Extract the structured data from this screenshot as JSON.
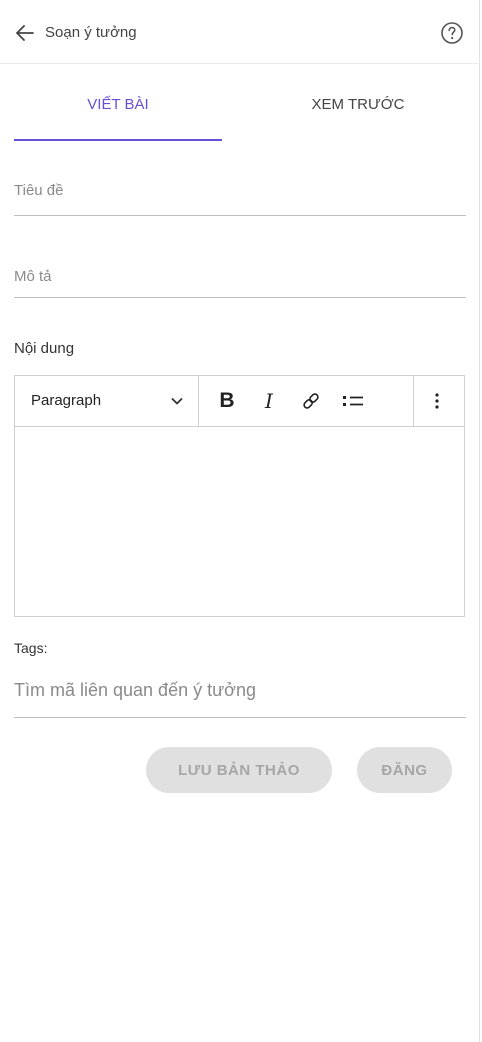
{
  "header": {
    "title": "Soạn ý tưởng",
    "back_icon": "arrow-left-icon",
    "help_icon": "help-circle-icon"
  },
  "tabs": [
    {
      "label": "VIẾT BÀI",
      "active": true
    },
    {
      "label": "XEM TRƯỚC",
      "active": false
    }
  ],
  "form": {
    "title_placeholder": "Tiêu đề",
    "description_placeholder": "Mô tả",
    "content_label": "Nội dung",
    "editor": {
      "format_selected": "Paragraph",
      "buttons": [
        "bold-icon",
        "italic-icon",
        "link-icon",
        "bulleted-list-icon",
        "more-vertical-icon"
      ],
      "bold_glyph": "B",
      "italic_glyph": "I"
    },
    "tags_label": "Tags:",
    "tags_placeholder": "Tìm mã liên quan đến ý tưởng"
  },
  "actions": {
    "save_draft_label": "LƯU BẢN THẢO",
    "post_label": "ĐĂNG"
  },
  "colors": {
    "accent": "#6a4fd6",
    "disabled_bg": "#e0e0e0",
    "disabled_text": "#a6a6a6"
  }
}
